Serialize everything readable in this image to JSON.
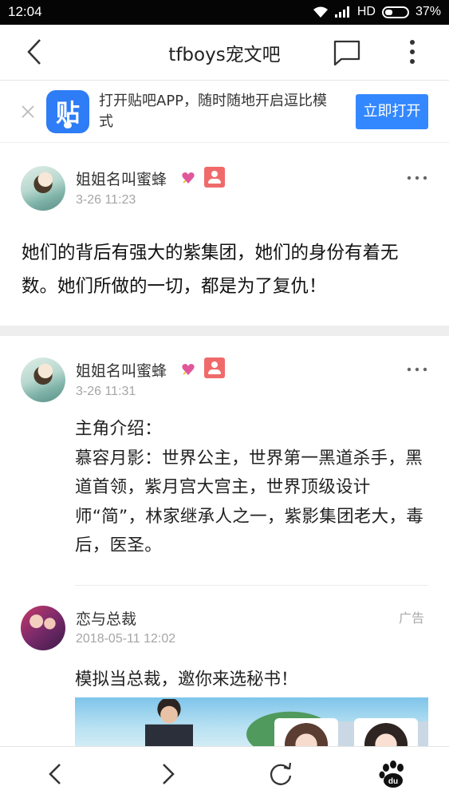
{
  "status_bar": {
    "time": "12:04",
    "network": "HD",
    "battery": "37%"
  },
  "header": {
    "title": "tfboys宠文吧"
  },
  "app_banner": {
    "promo_text": "打开贴吧APP，随时随地开启逗比模式",
    "logo_text": "贴",
    "open_button": "立即打开"
  },
  "posts": [
    {
      "username": "姐姐名叫蜜蜂",
      "time": "3-26 11:23",
      "content": "她们的背后有强大的紫集团，她们的身份有着无数。她们所做的一切，都是为了复仇！"
    },
    {
      "username": "姐姐名叫蜜蜂",
      "time": "3-26 11:31",
      "content_lines": [
        "主角介绍：",
        "慕容月影：世界公主，世界第一黑道杀手，黑道首领，紫月宫大宫主，世界顶级设计师“简”，林家继承人之一，紫影集团老大，毒后，医圣。"
      ]
    }
  ],
  "ad": {
    "name": "恋与总裁",
    "label": "广告",
    "time": "2018-05-11 12:02",
    "text": "模拟当总裁，邀你来选秘书！"
  },
  "icons": {
    "back": "back-icon",
    "comment": "comment-icon",
    "more": "more-vertical-icon",
    "close": "close-icon",
    "heart": "sparkling-heart-icon",
    "badge": "user-badge-icon",
    "dots": "more-horizontal-icon",
    "nav_back": "chevron-left-icon",
    "nav_forward": "chevron-right-icon",
    "refresh": "refresh-icon",
    "baidu": "baidu-paw-icon"
  },
  "colors": {
    "accent": "#3388ff",
    "badge": "#f06a6a",
    "heart": "#e0579a"
  }
}
